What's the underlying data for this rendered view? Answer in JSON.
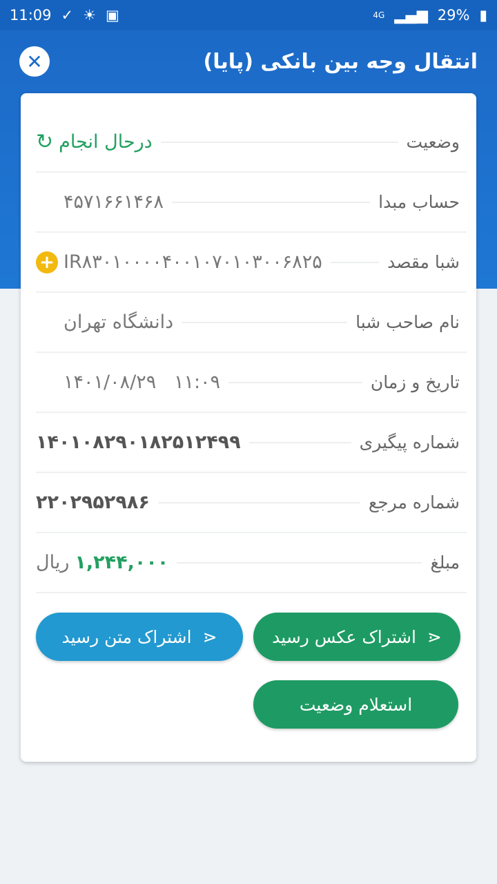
{
  "status_bar": {
    "time": "11:09",
    "battery": "29%",
    "network": "4G"
  },
  "header": {
    "title": "انتقال وجه بین بانکی (پایا)"
  },
  "rows": [
    {
      "label": "وضعیت",
      "value": "درحال انجام"
    },
    {
      "label": "حساب مبدا",
      "value": "۴۵۷۱۶۶۱۴۶۸"
    },
    {
      "label": "شبا مقصد",
      "value": "IR۸۳۰۱۰۰۰۰۴۰۰۱۰۷۰۱۰۳۰۰۶۸۲۵"
    },
    {
      "label": "نام صاحب شبا",
      "value": "دانشگاه تهران"
    },
    {
      "label": "تاریخ و زمان",
      "value": "۱۴۰۱/۰۸/۲۹   ۱۱:۰۹"
    },
    {
      "label": "شماره پیگیری",
      "value": "۱۴۰۱۰۸۲۹۰۱۸۲۵۱۲۴۹۹"
    },
    {
      "label": "شماره مرجع",
      "value": "۲۲۰۲۹۵۲۹۸۶"
    },
    {
      "label": "مبلغ",
      "value": "۱,۲۴۴,۰۰۰",
      "unit": "ریال"
    }
  ],
  "buttons": {
    "share_image": "اشتراک عکس رسید",
    "share_text": "اشتراک متن رسید",
    "inquiry": "استعلام وضعیت"
  }
}
